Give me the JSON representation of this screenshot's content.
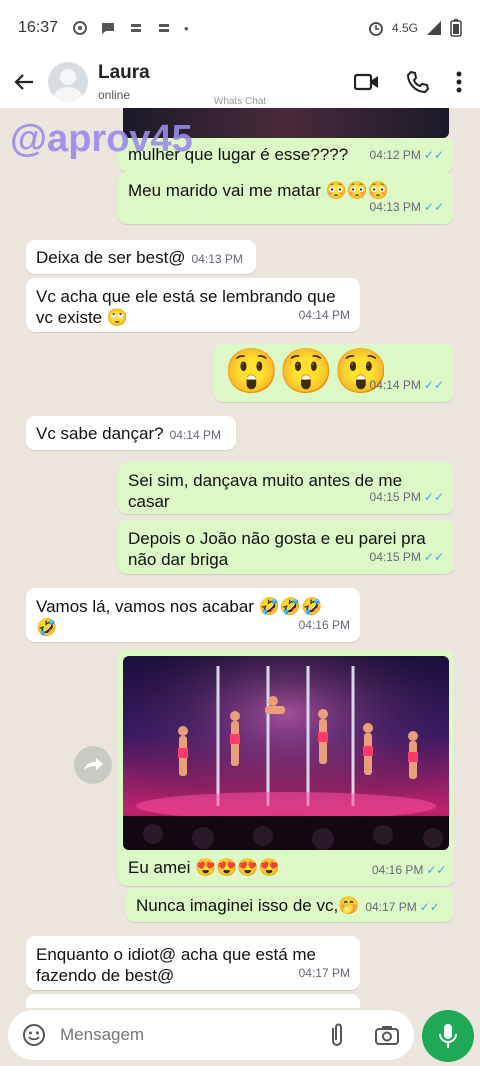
{
  "status": {
    "time": "16:37",
    "network": "4.5G"
  },
  "header": {
    "name": "Laura",
    "status": "online",
    "brand": "Whats Chat"
  },
  "watermark": "@aprov45",
  "messages": [
    {
      "text": "mulher que lugar é esse????",
      "time": "04:12 PM"
    },
    {
      "text": "Meu marido vai me matar 😳😳😳",
      "time": "04:13 PM"
    },
    {
      "text": "Deixa de ser best@",
      "time": "04:13 PM"
    },
    {
      "text": "Vc acha que ele está se lembrando que vc existe 🙄",
      "time": "04:14 PM"
    },
    {
      "text": "😲😲😲",
      "time": "04:14 PM"
    },
    {
      "text": "Vc sabe dançar?",
      "time": "04:14 PM"
    },
    {
      "text": "Sei sim, dançava muito antes de me casar",
      "time": "04:15 PM"
    },
    {
      "text": "Depois o João não gosta e eu parei pra não dar briga",
      "time": "04:15 PM"
    },
    {
      "text": "Vamos lá, vamos nos acabar 🤣🤣🤣🤣",
      "time": "04:16 PM"
    },
    {
      "text": "Eu amei 😍😍😍😍",
      "time": "04:16 PM"
    },
    {
      "text": "Nunca imaginei isso de vc,🤭",
      "time": "04:17 PM"
    },
    {
      "text": "Enquanto o idiot@ acha que está me fazendo de best@",
      "time": "04:17 PM"
    }
  ],
  "input": {
    "placeholder": "Mensagem"
  }
}
